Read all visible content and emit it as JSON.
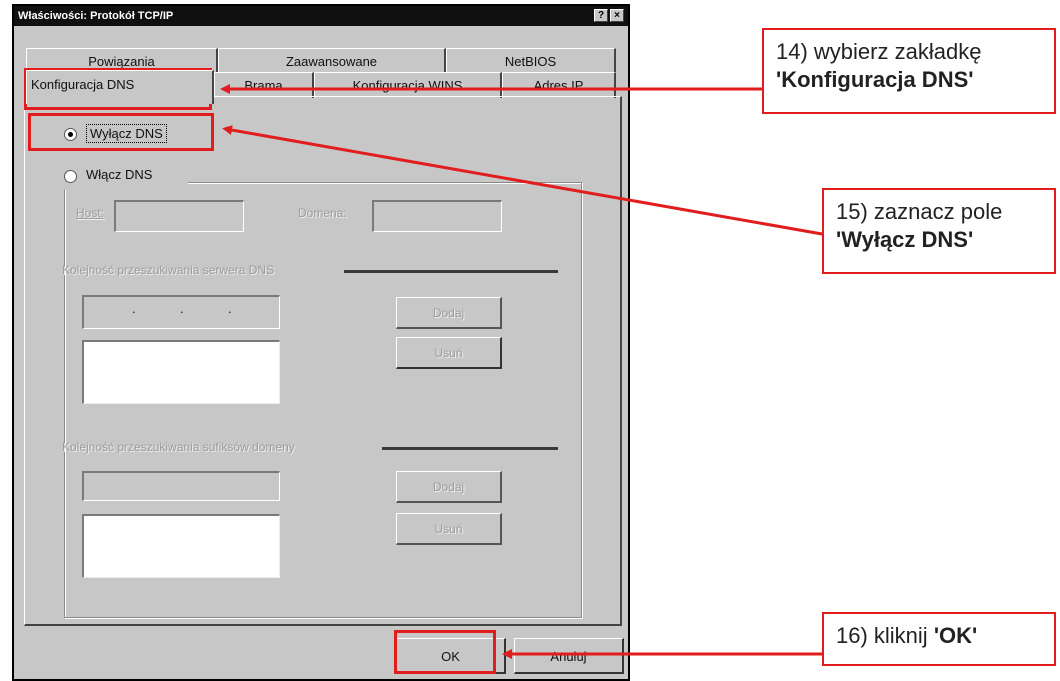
{
  "dialog": {
    "title": "Właściwości: Protokół TCP/IP",
    "title_buttons": [
      "?",
      "×"
    ],
    "tabs_row1": [
      "Powiązania",
      "Zaawansowane",
      "NetBIOS"
    ],
    "tabs_row2": [
      "Konfiguracja DNS",
      "Brama",
      "Konfiguracja WINS",
      "Adres IP"
    ],
    "active_tab": "Konfiguracja DNS",
    "radio_disable": "Wyłącz DNS",
    "radio_enable": "Włącz DNS",
    "selected_radio": "Wyłącz DNS",
    "host_label": "Host:",
    "domain_label": "Domena:",
    "dns_order_label": "Kolejność przeszukiwania serwera DNS",
    "suffix_order_label": "Kolejność przeszukiwania sufiksów domeny",
    "add_label": "Dodaj",
    "remove_label": "Usuń",
    "ip_separators": [
      ".",
      ".",
      "."
    ],
    "ok_label": "OK",
    "cancel_label": "Anuluj"
  },
  "annotations": {
    "step14_prefix": "14) wybierz zakładkę",
    "step14_bold": "'Konfiguracja DNS'",
    "step15_prefix": "15) zaznacz pole",
    "step15_bold": "'Wyłącz DNS'",
    "step16_prefix": "16) kliknij ",
    "step16_bold": "'OK'",
    "highlight_color": "#e11d1d"
  }
}
